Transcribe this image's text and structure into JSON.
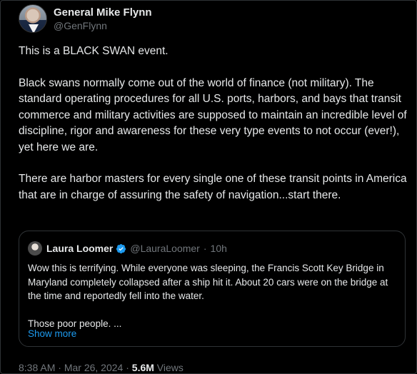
{
  "author": {
    "display_name": "General Mike Flynn",
    "handle": "@GenFlynn"
  },
  "tweet": {
    "paragraphs": [
      "This is a BLACK SWAN event.",
      "Black swans normally come out of the world of finance (not military). The standard operating procedures for all U.S. ports, harbors, and bays that transit commerce and military activities are supposed to maintain an incredible level of discipline, rigor and awareness for these very type events to not occur (ever!), yet here we are.",
      "There are harbor masters for every single one of these transit points in America that are in charge of assuring the safety of navigation...start there."
    ]
  },
  "quoted": {
    "display_name": "Laura Loomer",
    "handle": "@LauraLoomer",
    "separator": "·",
    "time": "10h",
    "paragraphs": [
      "Wow this is terrifying. While everyone was sleeping, the Francis Scott Key Bridge in Maryland completely collapsed after a ship hit it. About 20 cars were on the bridge at the time and reportedly fell into the water.",
      "Those poor people. ..."
    ],
    "show_more": "Show more"
  },
  "meta": {
    "time": "8:38 AM",
    "dot": "·",
    "date": "Mar 26, 2024",
    "views_count": "5.6M",
    "views_label": "Views"
  },
  "colors": {
    "background": "#000000",
    "text": "#e7e9ea",
    "muted": "#71767b",
    "link": "#1d9bf0",
    "border": "#2f3336"
  }
}
